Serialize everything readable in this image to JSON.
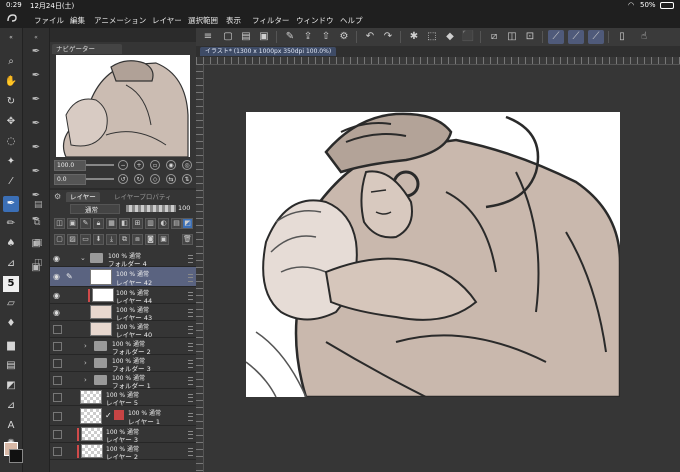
{
  "status": {
    "time": "0:29",
    "date": "12月24日(土)",
    "battery": "50%"
  },
  "menu": [
    "ファイル",
    "編集",
    "アニメーション",
    "レイヤー",
    "選択範囲",
    "表示",
    "フィルター",
    "ウィンドウ",
    "ヘルプ"
  ],
  "navigator": {
    "tab": "ナビゲーター",
    "zoom": "100.0",
    "angle": "0.0"
  },
  "document": {
    "tab": "イラスト* (1300 x 1000px 350dpi 100.0%)"
  },
  "layers": {
    "tab_layer": "レイヤー",
    "tab_property": "レイヤープロパティ",
    "blend_mode": "通常",
    "opacity": "100",
    "rows": [
      {
        "l1": "100 % 通常",
        "l2": "フォルダー 4",
        "kind": "folder",
        "open": true,
        "eye": true,
        "indent": 0
      },
      {
        "l1": "100 % 通常",
        "l2": "レイヤー 42",
        "kind": "layer",
        "thumb": "white",
        "eye": true,
        "selected": true,
        "indent": 1,
        "pen": true
      },
      {
        "l1": "100 % 通常",
        "l2": "レイヤー 44",
        "kind": "layer",
        "thumb": "white",
        "eye": true,
        "indent": 1,
        "clip": true
      },
      {
        "l1": "100 % 通常",
        "l2": "レイヤー 43",
        "kind": "layer",
        "thumb": "tan",
        "eye": true,
        "indent": 1
      },
      {
        "l1": "100 % 通常",
        "l2": "レイヤー 40",
        "kind": "layer",
        "thumb": "tan",
        "eye": false,
        "indent": 1
      },
      {
        "l1": "100 % 通常",
        "l2": "フォルダー 2",
        "kind": "folder",
        "open": false,
        "eye": false,
        "indent": 0
      },
      {
        "l1": "100 % 通常",
        "l2": "フォルダー 3",
        "kind": "folder",
        "open": false,
        "eye": false,
        "indent": 0
      },
      {
        "l1": "100 % 通常",
        "l2": "フォルダー 1",
        "kind": "folder",
        "open": false,
        "eye": false,
        "indent": 0
      },
      {
        "l1": "100 % 通常",
        "l2": "レイヤー 5",
        "kind": "layer",
        "thumb": "checker",
        "eye": false,
        "indent": 0
      },
      {
        "l1": "100 % 通常",
        "l2": "レイヤー 1",
        "kind": "layer",
        "thumb": "checker",
        "eye": false,
        "indent": 0,
        "check": true
      },
      {
        "l1": "100 % 通常",
        "l2": "レイヤー 3",
        "kind": "layer",
        "thumb": "checker",
        "eye": false,
        "indent": 0,
        "clip": true
      },
      {
        "l1": "100 % 通常",
        "l2": "レイヤー 2",
        "kind": "layer",
        "thumb": "checker",
        "eye": false,
        "indent": 0
      }
    ]
  },
  "colors": {
    "main": "#d8b9a7",
    "sub": "#111111",
    "selection": "#5a6380",
    "active_tool": "#3b6fb6"
  },
  "tools": [
    "zoom-icon",
    "hand-icon",
    "rotate-icon",
    "move-icon",
    "lasso-icon",
    "wand-icon",
    "eyedropper-icon",
    "pen-icon",
    "pencil-icon",
    "brush-icon",
    "airbrush-icon",
    "decoration-icon",
    "eraser-icon",
    "blend-icon",
    "fill-icon",
    "gradient-icon",
    "figure-icon",
    "frame-icon",
    "ruler-icon",
    "text-icon",
    "balloon-icon",
    "correction-icon"
  ]
}
